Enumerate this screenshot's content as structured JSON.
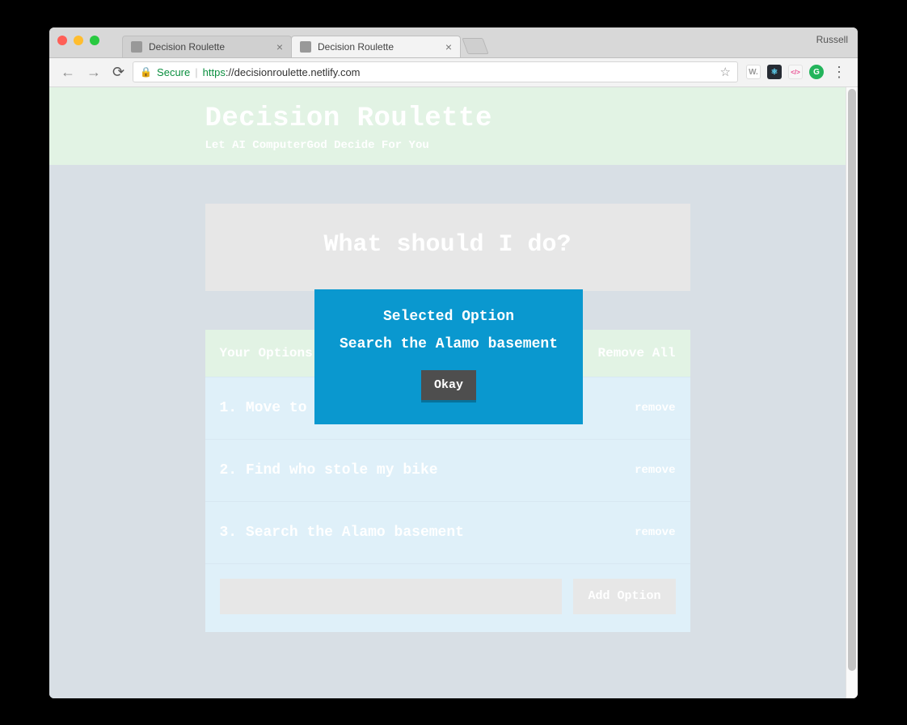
{
  "chrome": {
    "user_label": "Russell",
    "tabs": [
      {
        "title": "Decision Roulette",
        "active": false
      },
      {
        "title": "Decision Roulette",
        "active": true
      }
    ],
    "secure_label": "Secure",
    "url_scheme": "https",
    "url_rest": "://decisionroulette.netlify.com"
  },
  "header": {
    "title": "Decision Roulette",
    "subtitle": "Let AI ComputerGod Decide For You"
  },
  "action_button": "What should I do?",
  "options_header": {
    "label": "Your Options",
    "remove_all": "Remove All"
  },
  "options": [
    {
      "text": "Move to Tuscon",
      "remove": "remove"
    },
    {
      "text": "Find who stole my bike",
      "remove": "remove"
    },
    {
      "text": "Search the Alamo basement",
      "remove": "remove"
    }
  ],
  "add": {
    "button": "Add Option",
    "placeholder": ""
  },
  "modal": {
    "title": "Selected Option",
    "value": "Search the Alamo basement",
    "ok": "Okay"
  }
}
